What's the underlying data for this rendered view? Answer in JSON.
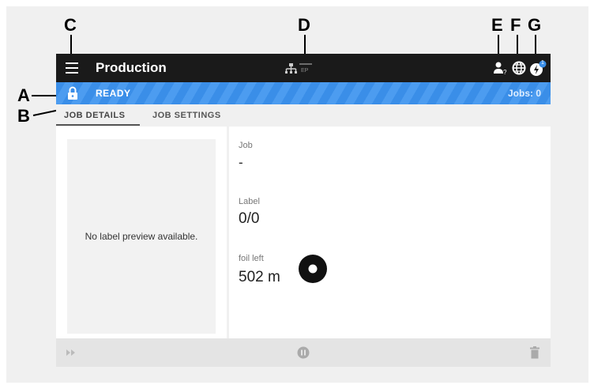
{
  "callouts": {
    "a": "A",
    "b": "B",
    "c": "C",
    "d": "D",
    "e": "E",
    "f": "F",
    "g": "G"
  },
  "topbar": {
    "title": "Production",
    "menu_icon": "hamburger-menu-icon",
    "network_icon": "network-ep-icon",
    "network_label": "EP",
    "user_icon": "user-icon",
    "globe_icon": "globe-icon",
    "notification_icon": "lightning-icon",
    "notification_count": "1"
  },
  "status": {
    "state": "READY",
    "jobs": "Jobs: 0",
    "lock_icon": "lock-icon",
    "color": "#3a8ee8"
  },
  "tabs": [
    {
      "label": "JOB DETAILS",
      "active": true
    },
    {
      "label": "JOB SETTINGS",
      "active": false
    }
  ],
  "preview": {
    "message": "No label preview available."
  },
  "details": {
    "job_label": "Job",
    "job_value": "-",
    "label_label": "Label",
    "label_value": "0/0",
    "foil_label": "foil left",
    "foil_value": "502 m",
    "foil_icon": "foil-roll-icon"
  },
  "bottombar": {
    "skip_icon": "fast-forward-icon",
    "pause_icon": "pause-icon",
    "delete_icon": "trash-icon"
  }
}
